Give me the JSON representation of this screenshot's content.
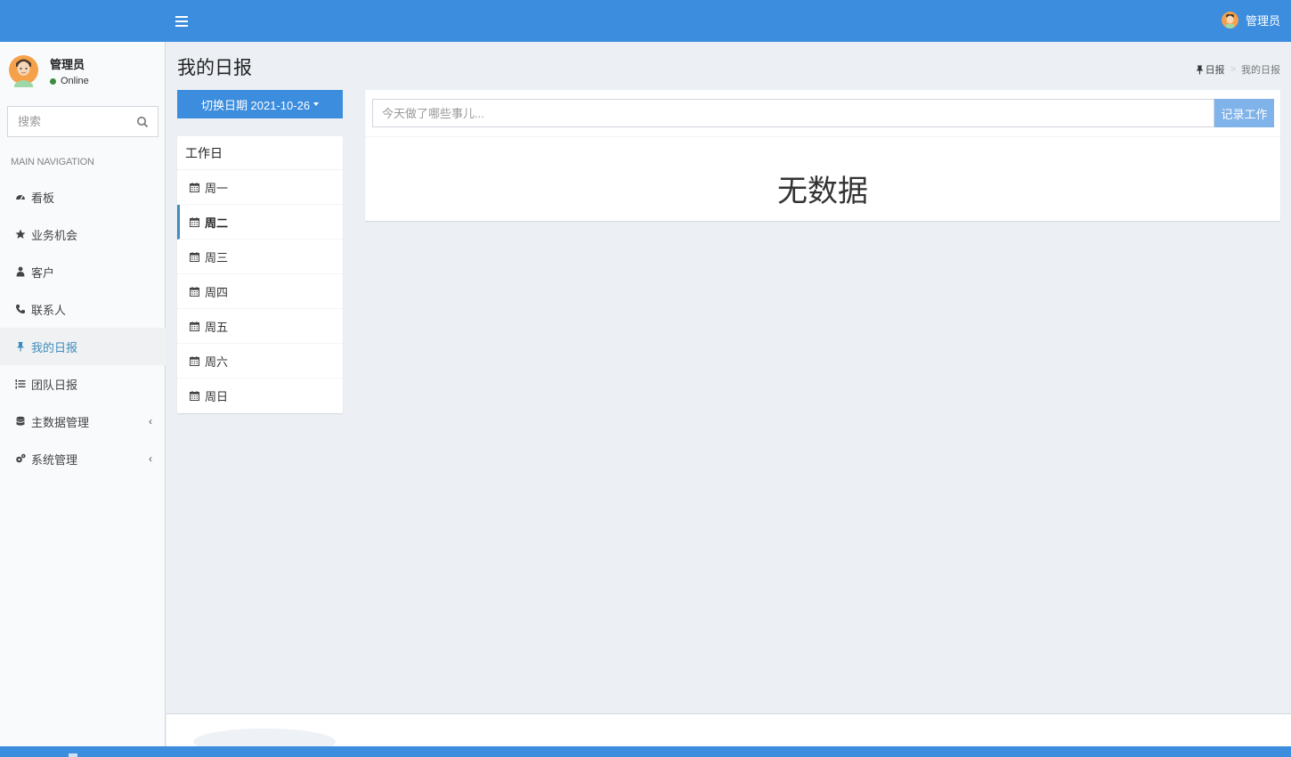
{
  "header": {
    "menu_toggle_icon": "bars-icon",
    "user_name": "管理员"
  },
  "sidebar": {
    "user": {
      "name": "管理员",
      "status": "Online",
      "status_color": "#3d8b3d"
    },
    "search": {
      "placeholder": "搜索",
      "icon": "search-icon"
    },
    "nav_header": "MAIN NAVIGATION",
    "items": [
      {
        "label": "看板",
        "icon": "dashboard-icon"
      },
      {
        "label": "业务机会",
        "icon": "star-icon"
      },
      {
        "label": "客户",
        "icon": "user-tie-icon"
      },
      {
        "label": "联系人",
        "icon": "phone-icon"
      },
      {
        "label": "我的日报",
        "icon": "thumbtack-icon",
        "active": true
      },
      {
        "label": "团队日报",
        "icon": "list-ol-icon"
      },
      {
        "label": "主数据管理",
        "icon": "database-icon",
        "expandable": true
      },
      {
        "label": "系统管理",
        "icon": "cogs-icon",
        "expandable": true
      }
    ]
  },
  "page": {
    "title": "我的日报",
    "breadcrumb": {
      "parent": "日报",
      "current": "我的日报"
    }
  },
  "date_switch": {
    "label": "切换日期 2021-10-26"
  },
  "workdays": {
    "title": "工作日",
    "items": [
      "周一",
      "周二",
      "周三",
      "周四",
      "周五",
      "周六",
      "周日"
    ],
    "active_index": 1
  },
  "log": {
    "placeholder": "今天做了哪些事儿...",
    "submit_label": "记录工作",
    "empty_text": "无数据"
  },
  "colors": {
    "primary": "#3c8dde",
    "button_light": "#80b3ea",
    "active_link": "#3c8dbc"
  }
}
